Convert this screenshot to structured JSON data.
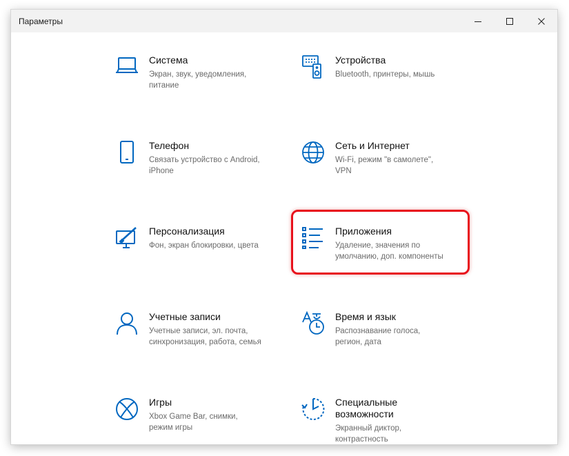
{
  "window": {
    "title": "Параметры"
  },
  "titlebar": {
    "minimize": "minimize-icon",
    "maximize": "maximize-icon",
    "close": "close-icon"
  },
  "accent_color": "#0067c0",
  "highlight_color": "#e8111c",
  "tiles": [
    {
      "title": "Система",
      "desc_lines": [
        "Экран, звук, уведомления,",
        "питание"
      ],
      "icon": "laptop-icon"
    },
    {
      "title": "Устройства",
      "desc_lines": [
        "Bluetooth, принтеры, мышь"
      ],
      "icon": "devices-icon"
    },
    {
      "title": "Телефон",
      "desc_lines": [
        "Связать устройство с Android,",
        "iPhone"
      ],
      "icon": "phone-icon"
    },
    {
      "title": "Сеть и Интернет",
      "desc_lines": [
        "Wi-Fi, режим \"в самолете\",",
        "VPN"
      ],
      "icon": "globe-icon"
    },
    {
      "title": "Персонализация",
      "desc_lines": [
        "Фон, экран блокировки, цвета"
      ],
      "icon": "personalization-icon"
    },
    {
      "title": "Приложения",
      "desc_lines": [
        "Удаление, значения по",
        "умолчанию, доп. компоненты"
      ],
      "icon": "apps-list-icon"
    },
    {
      "title": "Учетные записи",
      "desc_lines": [
        "Учетные записи, эл. почта,",
        "синхронизация, работа, семья"
      ],
      "icon": "person-icon"
    },
    {
      "title": "Время и язык",
      "desc_lines": [
        "Распознавание голоса,",
        "регион, дата"
      ],
      "icon": "time-language-icon"
    },
    {
      "title": "Игры",
      "desc_lines": [
        "Xbox Game Bar, снимки,",
        "режим игры"
      ],
      "icon": "xbox-icon"
    },
    {
      "title_lines": [
        "Специальные",
        "возможности"
      ],
      "desc_lines": [
        "Экранный диктор,",
        "контрастность"
      ],
      "icon": "accessibility-timer-icon"
    }
  ]
}
